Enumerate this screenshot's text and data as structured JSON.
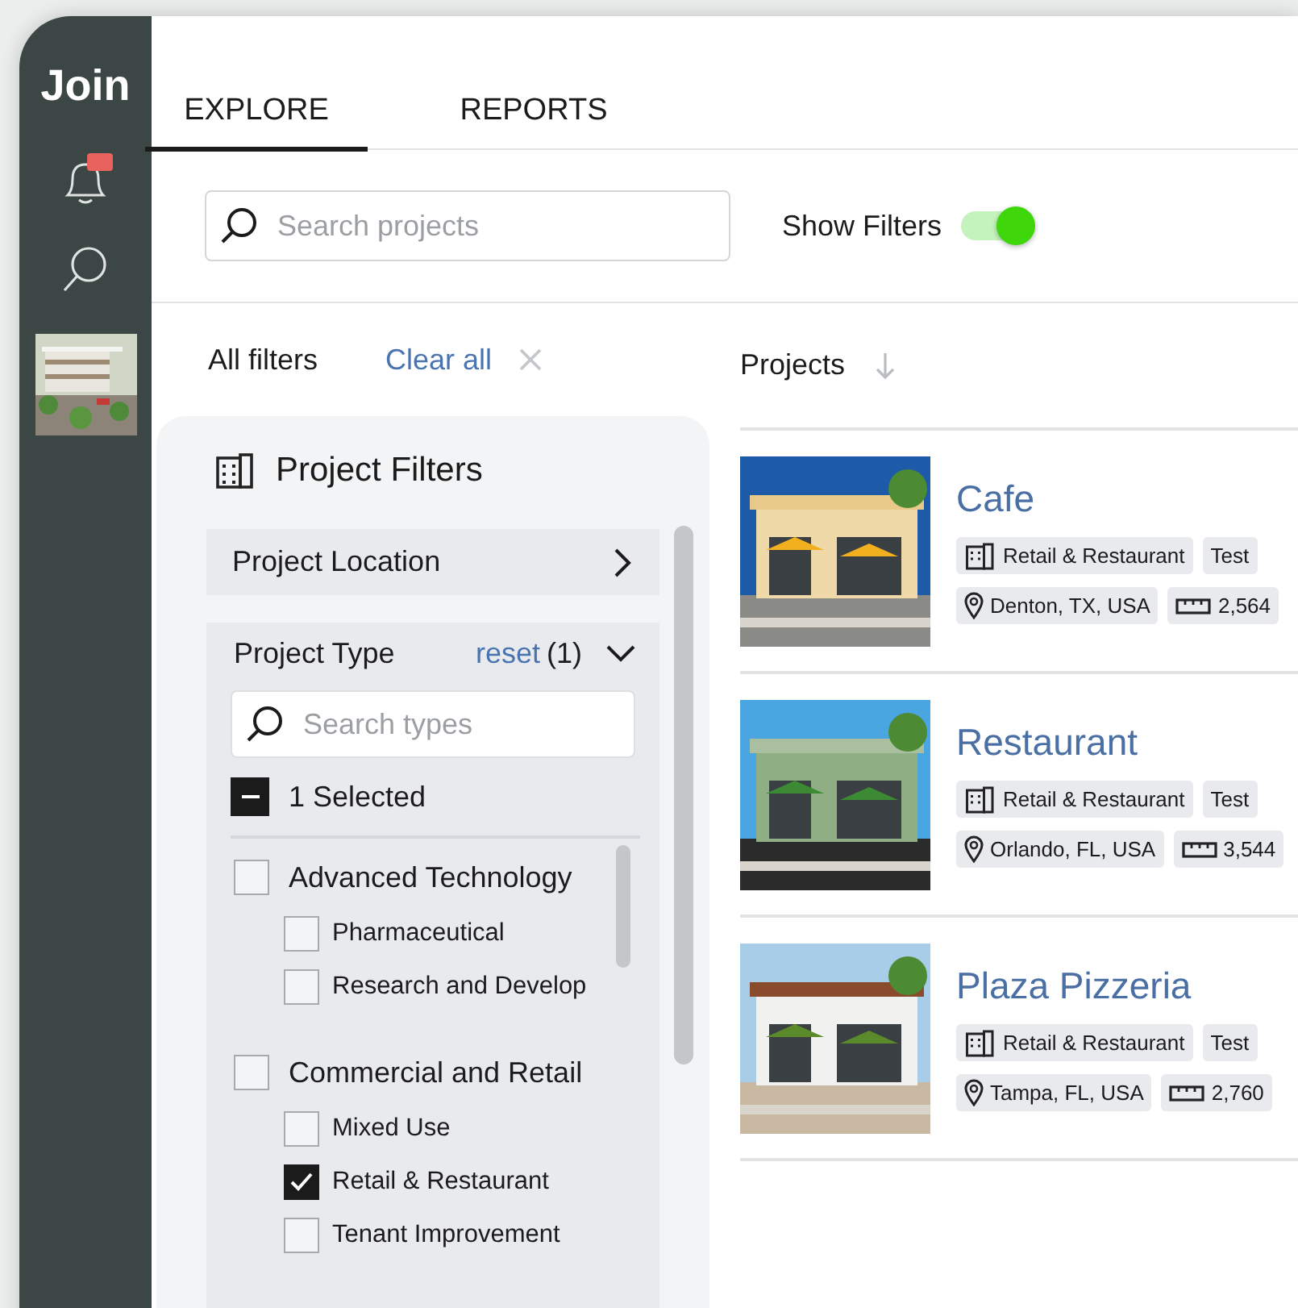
{
  "sidebar": {
    "logo": "Join",
    "items": [
      {
        "kind": "bell",
        "badge": true
      },
      {
        "kind": "search"
      },
      {
        "kind": "picture"
      }
    ]
  },
  "tabs": [
    {
      "label": "EXPLORE",
      "selected": true
    },
    {
      "label": "REPORTS",
      "selected": false
    }
  ],
  "search": {
    "placeholder": "Search projects"
  },
  "show_filters": {
    "label": "Show Filters",
    "on": true
  },
  "filters_header": {
    "title": "All filters",
    "clear": "Clear all"
  },
  "filter_panel": {
    "title": "Project Filters",
    "sections": [
      {
        "title": "Project Location",
        "expanded": false
      },
      {
        "title": "Project Type",
        "expanded": true,
        "reset": "reset",
        "count": "(1)",
        "search_placeholder": "Search types",
        "select_all": {
          "label": "1 Selected",
          "indeterminate": true
        },
        "types": [
          {
            "label": "Advanced Technology",
            "checked": false,
            "children": [
              {
                "label": "Pharmaceutical",
                "checked": false
              },
              {
                "label": "Research and Develop",
                "checked": false
              }
            ]
          },
          {
            "label": "Commercial and Retail",
            "checked": false,
            "children": [
              {
                "label": "Mixed Use",
                "checked": false
              },
              {
                "label": "Retail & Restaurant",
                "checked": true
              },
              {
                "label": "Tenant Improvement",
                "checked": false
              }
            ]
          }
        ]
      }
    ]
  },
  "projects": {
    "title": "Projects",
    "items": [
      {
        "name": "Cafe",
        "type": "Retail & Restaurant",
        "tag": "Test",
        "location": "Denton, TX, USA",
        "size": "2,564"
      },
      {
        "name": "Restaurant",
        "type": "Retail & Restaurant",
        "tag": "Test",
        "location": "Orlando, FL, USA",
        "size": "3,544"
      },
      {
        "name": "Plaza Pizzeria",
        "type": "Retail & Restaurant",
        "tag": "Test",
        "location": "Tampa, FL, USA",
        "size": "2,760"
      }
    ]
  }
}
